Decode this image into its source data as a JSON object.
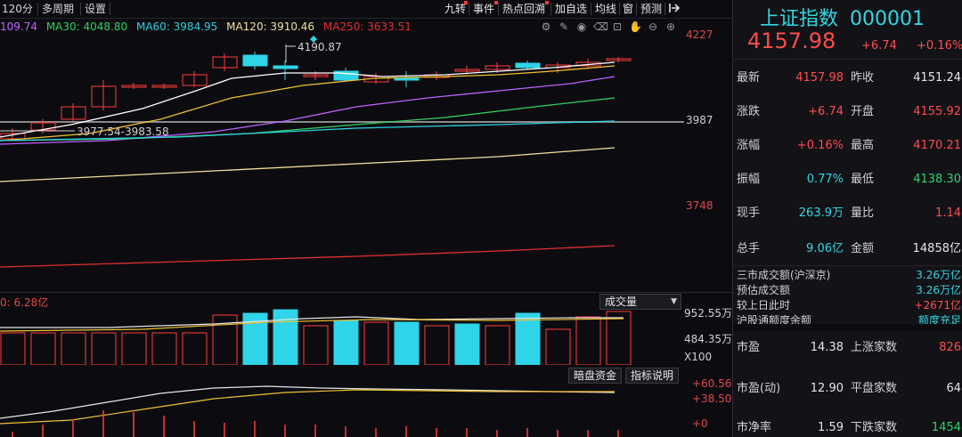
{
  "toolbar": {
    "left": [
      "120分",
      "多周期",
      "设置"
    ],
    "right": [
      "九转",
      "事件",
      "热点回溯",
      "加自选",
      "均线",
      "窗",
      "预测"
    ]
  },
  "ma_row": {
    "ma20": "109.74",
    "ma30": "MA30: 4048.80",
    "ma60": "MA60: 3984.95",
    "ma120": "MA120: 3910.46",
    "ma250": "MA250: 3633.51"
  },
  "price_axis": {
    "top": "4227",
    "mid": "3987",
    "low": "3748"
  },
  "annotations": {
    "high_label": "4190.87",
    "range_label": "3977.54-3983.58"
  },
  "volume": {
    "header": "0: 6.28亿",
    "dropdown": "成交量",
    "axis_top": "952.55万",
    "axis_mid": "484.35万",
    "axis_unit": "X100"
  },
  "buttons": {
    "dark_pool": "暗盘资金",
    "indicator_help": "指标说明"
  },
  "indicator_axis": {
    "top": "+60.56",
    "mid": "+38.50",
    "bottom": "+0"
  },
  "quote": {
    "name": "上证指数",
    "code": "000001",
    "price": "4157.98",
    "change": "+6.74",
    "change_pct": "+0.16%",
    "rows": [
      {
        "l1": "最新",
        "v1": "4157.98",
        "c1": "red",
        "l2": "昨收",
        "v2": "4151.24",
        "c2": "white"
      },
      {
        "l1": "涨跌",
        "v1": "+6.74",
        "c1": "red",
        "l2": "开盘",
        "v2": "4155.92",
        "c2": "red"
      },
      {
        "l1": "涨幅",
        "v1": "+0.16%",
        "c1": "red",
        "l2": "最高",
        "v2": "4170.21",
        "c2": "red"
      },
      {
        "l1": "振幅",
        "v1": "0.77%",
        "c1": "cyan",
        "l2": "最低",
        "v2": "4138.30",
        "c2": "green"
      },
      {
        "l1": "现手",
        "v1": "263.9万",
        "c1": "cyan",
        "l2": "量比",
        "v2": "1.14",
        "c2": "red"
      },
      {
        "l1": "总手",
        "v1": "9.06亿",
        "c1": "cyan",
        "l2": "金额",
        "v2": "14858亿",
        "c2": "white"
      }
    ],
    "market": [
      {
        "label": "三市成交额(沪深京)",
        "value": "3.26万亿",
        "color": "cyan"
      },
      {
        "label": "预估成交额",
        "value": "3.26万亿",
        "color": "cyan"
      },
      {
        "label": "较上日此时",
        "value": "+2671亿",
        "color": "red"
      },
      {
        "label": "沪股通额度余额",
        "value": "额度充足",
        "color": "cyan"
      }
    ],
    "stats": [
      {
        "l1": "市盈",
        "v1": "14.38",
        "l2": "上涨家数",
        "v2": "826",
        "c2": "red"
      },
      {
        "l1": "市盈(动)",
        "v1": "12.90",
        "l2": "平盘家数",
        "v2": "64",
        "c2": "white"
      },
      {
        "l1": "市净率",
        "v1": "1.59",
        "l2": "下跌家数",
        "v2": "1454",
        "c2": "green"
      }
    ]
  },
  "colors": {
    "up": "#ff3b3b",
    "down": "#2fd4e8",
    "ma5": "#ffffff",
    "ma10": "#f0c030",
    "ma20": "#c060ff",
    "ma30": "#30d060",
    "ma60": "#30d0e0",
    "ma120": "#f0e0a0",
    "ma250": "#e03030"
  }
}
